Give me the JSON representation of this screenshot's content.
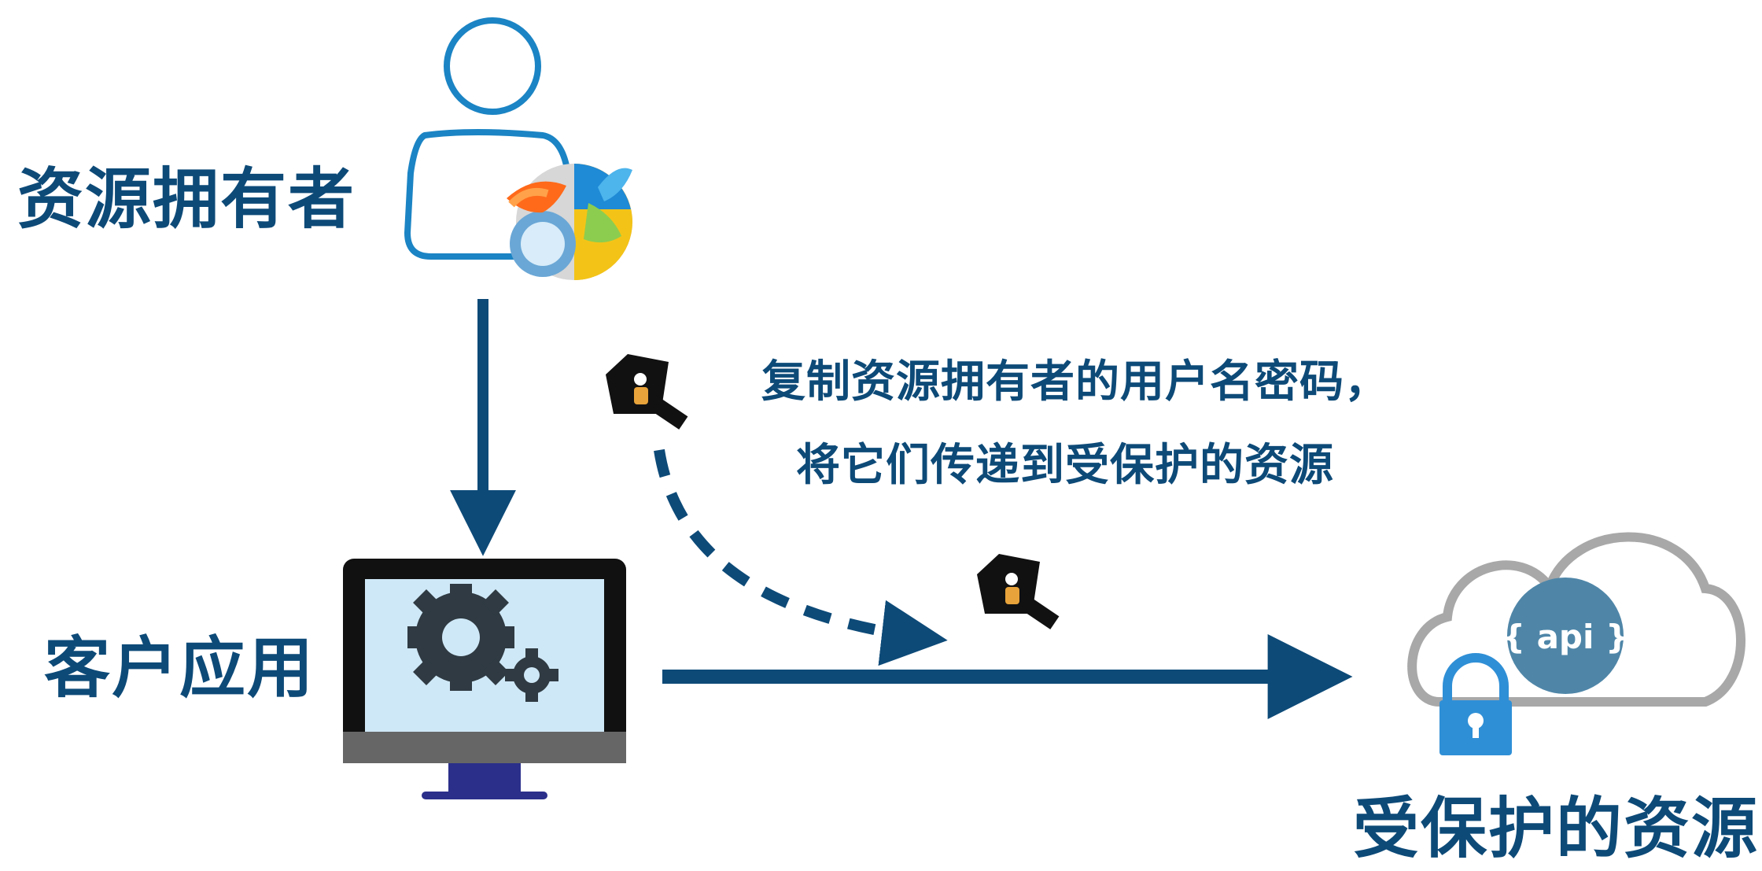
{
  "nodes": {
    "resource_owner": "资源拥有者",
    "client_app": "客户应用",
    "protected_resource": "受保护的资源"
  },
  "annotation": {
    "line1": "复制资源拥有者的用户名密码，",
    "line2": "将它们传递到受保护的资源"
  },
  "cloud_badge": "{ api }",
  "colors": {
    "primary": "#0d4a78",
    "user_outline": "#1b84c4",
    "screen": "#cfe8f7",
    "gear": "#2f3a42",
    "lock": "#2f8fd6",
    "api_circle": "#4f86a8",
    "cloud_outline": "#a8a8a8",
    "key_body": "#111111",
    "key_accent": "#e8a33a"
  },
  "icons": [
    "user-icon",
    "browser-icon",
    "monitor-icon",
    "gear-icon",
    "key-icon",
    "cloud-icon",
    "lock-icon"
  ]
}
